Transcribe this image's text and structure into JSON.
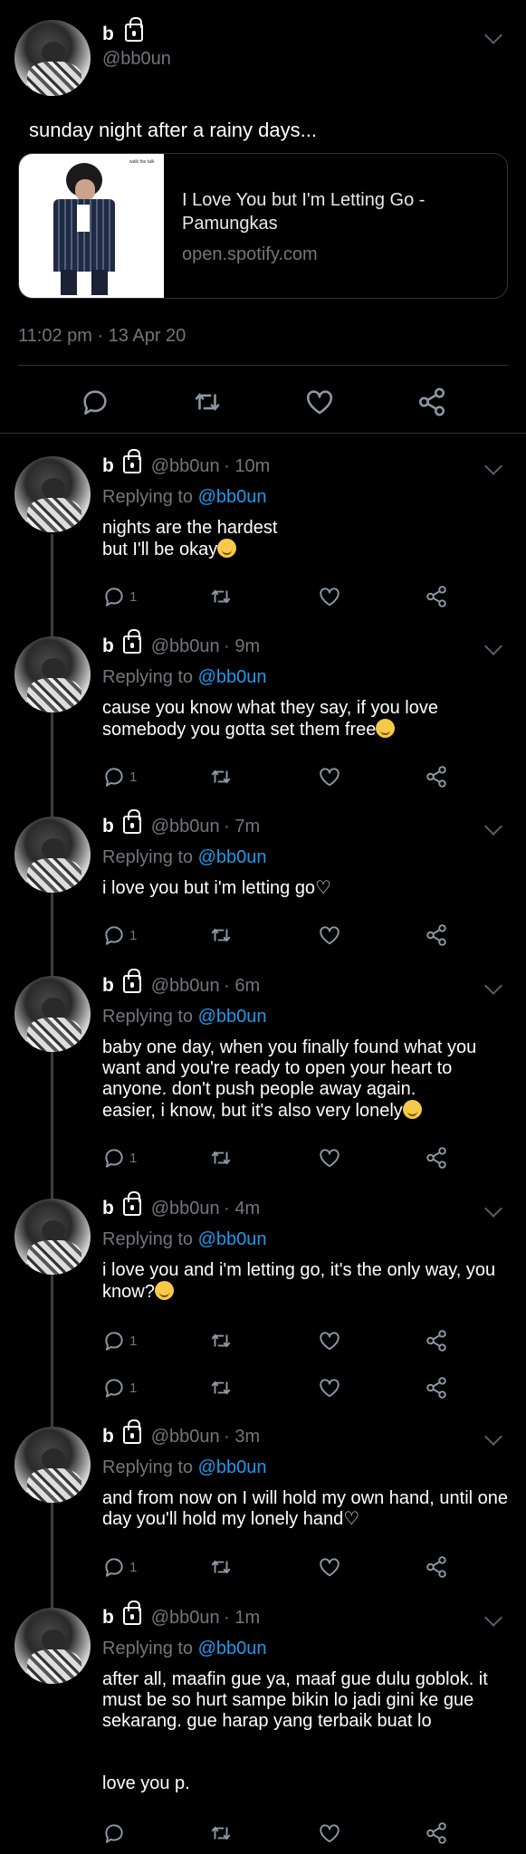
{
  "main_tweet": {
    "name": "b",
    "handle": "@bb0un",
    "text": "sunday night after a rainy days...",
    "card": {
      "title": "I Love You but I'm Letting Go - Pamungkas",
      "domain": "open.spotify.com",
      "album_caption": "walk the talk"
    },
    "timestamp": "11:02 pm · 13 Apr 20"
  },
  "replies": [
    {
      "name": "b",
      "handle": "@bb0un",
      "time": "· 10m",
      "replying_label": "Replying to",
      "replying_to": "@bb0un",
      "text": "nights are the hardest\nbut I'll be okay",
      "emoji": "relieved-face",
      "reply_count": "1"
    },
    {
      "name": "b",
      "handle": "@bb0un",
      "time": "· 9m",
      "replying_label": "Replying to",
      "replying_to": "@bb0un",
      "text": "cause you know what they say, if you love\nsomebody you gotta set them free",
      "emoji": "grinning-face",
      "reply_count": "1"
    },
    {
      "name": "b",
      "handle": "@bb0un",
      "time": "· 7m",
      "replying_label": "Replying to",
      "replying_to": "@bb0un",
      "text": "i love you but i'm letting go♡",
      "emoji": "",
      "reply_count": "1"
    },
    {
      "name": "b",
      "handle": "@bb0un",
      "time": "· 6m",
      "replying_label": "Replying to",
      "replying_to": "@bb0un",
      "text": "baby one day, when you finally found what you\nwant and you're ready to open your heart to\nanyone. don't push people away again.\neasier, i know, but it's also very lonely",
      "emoji": "grimacing-face",
      "reply_count": "1"
    },
    {
      "name": "b",
      "handle": "@bb0un",
      "time": "· 4m",
      "replying_label": "Replying to",
      "replying_to": "@bb0un",
      "text": "i love you and i'm letting go, it's the only way, you\nknow?",
      "emoji": "grinning-face",
      "reply_count": "1",
      "reply_count_2": "1"
    },
    {
      "name": "b",
      "handle": "@bb0un",
      "time": "· 3m",
      "replying_label": "Replying to",
      "replying_to": "@bb0un",
      "text": "and from now on I will hold my own hand, until one\nday you'll hold my lonely hand♡",
      "emoji": "",
      "reply_count": "1"
    },
    {
      "name": "b",
      "handle": "@bb0un",
      "time": "· 1m",
      "replying_label": "Replying to",
      "replying_to": "@bb0un",
      "text": "after all, maafin gue ya, maaf gue dulu goblok. it\nmust be so hurt sampe bikin lo jadi gini ke gue\nsekarang. gue harap yang terbaik buat lo\n\n\nlove you p.",
      "emoji": "",
      "reply_count": ""
    }
  ],
  "icons": [
    "reply-icon",
    "retweet-icon",
    "like-icon",
    "share-icon",
    "lock-icon",
    "chevron-down-icon"
  ],
  "colors": {
    "background": "#000000",
    "accent": "#1d9bf0",
    "secondary_text": "#71767b",
    "icon": "#8b98a5"
  }
}
